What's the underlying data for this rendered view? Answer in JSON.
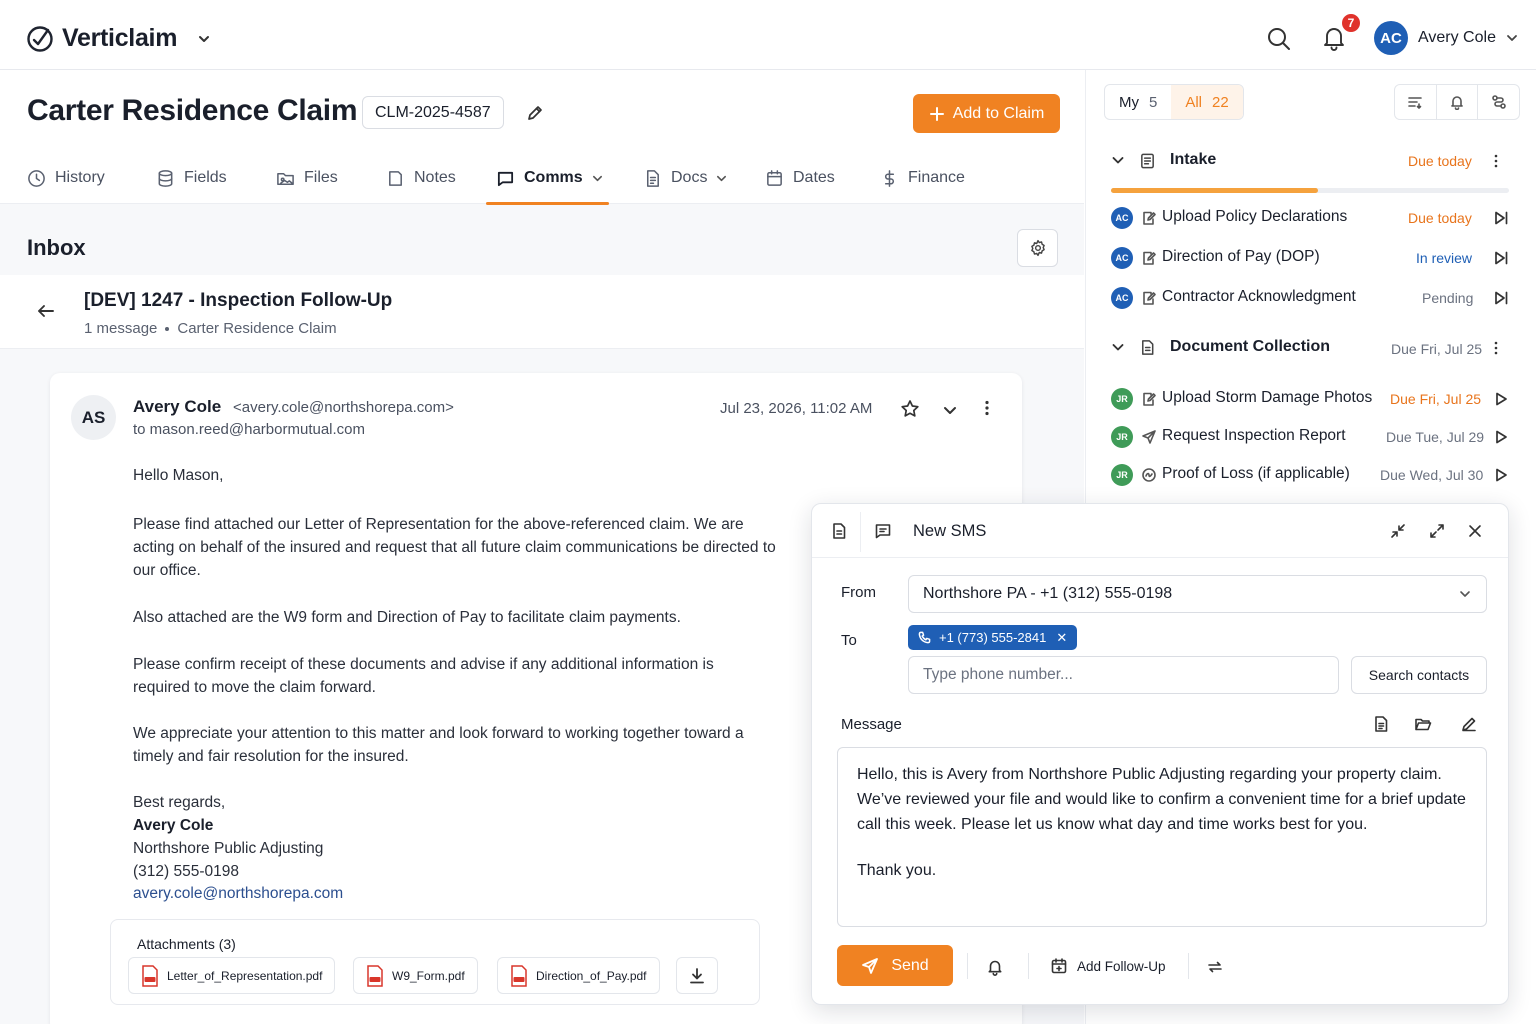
{
  "app": {
    "name": "Verticlaim",
    "notification_count": "7",
    "user_initials": "AC",
    "user_name": "Avery Cole"
  },
  "claim": {
    "title": "Carter Residence Claim",
    "id": "CLM-2025-4587",
    "add_button": "Add to Claim"
  },
  "tabs": [
    {
      "label": "History",
      "icon": "clock-icon"
    },
    {
      "label": "Fields",
      "icon": "database-icon"
    },
    {
      "label": "Files",
      "icon": "folder-image-icon"
    },
    {
      "label": "Notes",
      "icon": "note-icon"
    },
    {
      "label": "Comms",
      "icon": "chat-icon",
      "active": true
    },
    {
      "label": "Docs",
      "icon": "document-icon"
    },
    {
      "label": "Dates",
      "icon": "calendar-icon"
    },
    {
      "label": "Finance",
      "icon": "dollar-icon"
    }
  ],
  "inbox": {
    "title": "Inbox",
    "thread_title": "[DEV] 1247 - Inspection Follow-Up",
    "message_count": "1 message",
    "claim_ref": "Carter Residence Claim"
  },
  "email": {
    "sender_initials": "AS",
    "from_name": "Avery Cole",
    "from_email": "<avery.cole@northshorepa.com>",
    "to": "to mason.reed@harbormutual.com",
    "date": "Jul 23, 2026, 11:02 AM",
    "greeting": "Hello Mason,",
    "p1": "Please find attached our Letter of Representation for the above-referenced claim. We are acting on behalf of the insured and request that all future claim communications be directed to our office.",
    "p2": "Also attached are the W9 form and Direction of Pay to facilitate claim payments.",
    "p3": "Please confirm receipt of these documents and advise if any additional information is required to move the claim forward.",
    "p4": "We appreciate your attention to this matter and look forward to working together toward a timely and fair resolution for the insured.",
    "sign_off": "Best regards,",
    "sig_name": "Avery Cole",
    "sig_company": "Northshore Public Adjusting",
    "sig_phone": "(312) 555-0198",
    "sig_email": "avery.cole@northshorepa.com",
    "attachments_title": "Attachments (3)",
    "attachments": [
      "Letter_of_Representation.pdf",
      "W9_Form.pdf",
      "Direction_of_Pay.pdf"
    ]
  },
  "tasks_panel": {
    "my_label": "My",
    "my_count": "5",
    "all_label": "All",
    "all_count": "22",
    "groups": [
      {
        "title": "Intake",
        "due": "Due today",
        "progress": 0.52,
        "tasks": [
          {
            "initials": "AC",
            "name": "Upload Policy Declarations",
            "status": "Due today"
          },
          {
            "initials": "AC",
            "name": "Direction of Pay (DOP)",
            "status": "In review"
          },
          {
            "initials": "AC",
            "name": "Contractor Acknowledgment",
            "status": "Pending"
          }
        ]
      },
      {
        "title": "Document Collection",
        "due": "Due Fri, Jul 25",
        "tasks": [
          {
            "initials": "JR",
            "name": "Upload Storm Damage Photos",
            "status": "Due Fri, Jul 25"
          },
          {
            "initials": "JR",
            "name": "Request Inspection Report",
            "status": "Due Tue, Jul 29"
          },
          {
            "initials": "JR",
            "name": "Proof of Loss (if applicable)",
            "status": "Due Wed, Jul 30"
          }
        ]
      }
    ]
  },
  "sms": {
    "title": "New SMS",
    "from_label": "From",
    "from_value": "Northshore PA - +1 (312) 555-0198",
    "to_label": "To",
    "to_chip": "+1 (773) 555-2841",
    "phone_placeholder": "Type phone number...",
    "search_contacts": "Search contacts",
    "message_label": "Message",
    "message_p1": "Hello, this is Avery from Northshore Public Adjusting regarding your property claim. We’ve reviewed your file and would like to confirm a convenient time for a brief update call this week. Please let us know what day and time works best for you.",
    "message_p2": "Thank you.",
    "send": "Send",
    "add_followup": "Add Follow-Up"
  },
  "colors": {
    "accent": "#f08222",
    "due_orange": "#e8741c",
    "review_blue": "#1f5fb5",
    "avatar_ac": "#1f5fb5",
    "avatar_jr": "#3f9b58",
    "badge_red": "#e0322b"
  }
}
